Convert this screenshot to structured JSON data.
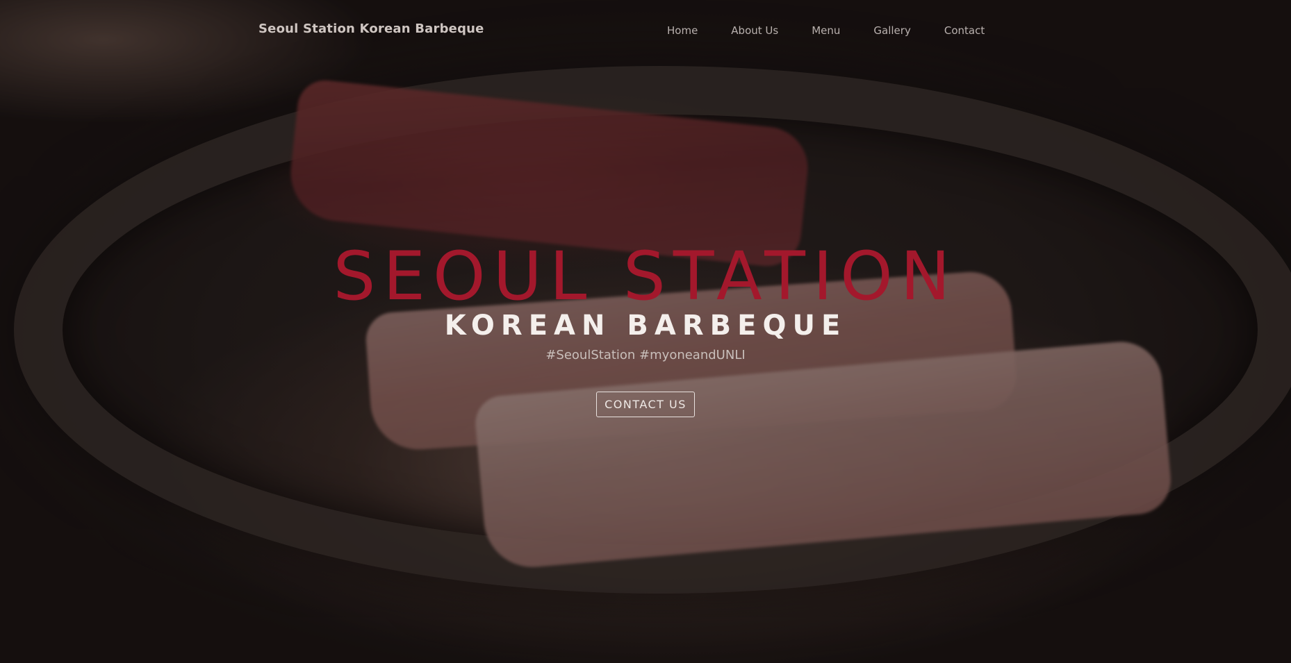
{
  "navbar": {
    "brand": "Seoul Station Korean Barbeque",
    "links": [
      {
        "label": "Home"
      },
      {
        "label": "About Us"
      },
      {
        "label": "Menu"
      },
      {
        "label": "Gallery"
      },
      {
        "label": "Contact"
      }
    ]
  },
  "hero": {
    "title": "SEOUL STATION",
    "subtitle": "KOREAN BARBEQUE",
    "tagline": "#SeoulStation #myoneandUNLI",
    "cta_label": "CONTACT US",
    "background_image": "grilled-meat-on-korean-bbq-pan",
    "colors": {
      "title": "#a3182c",
      "subtitle": "#f4efec",
      "overlay": "rgba(20,14,12,0.38)"
    }
  }
}
